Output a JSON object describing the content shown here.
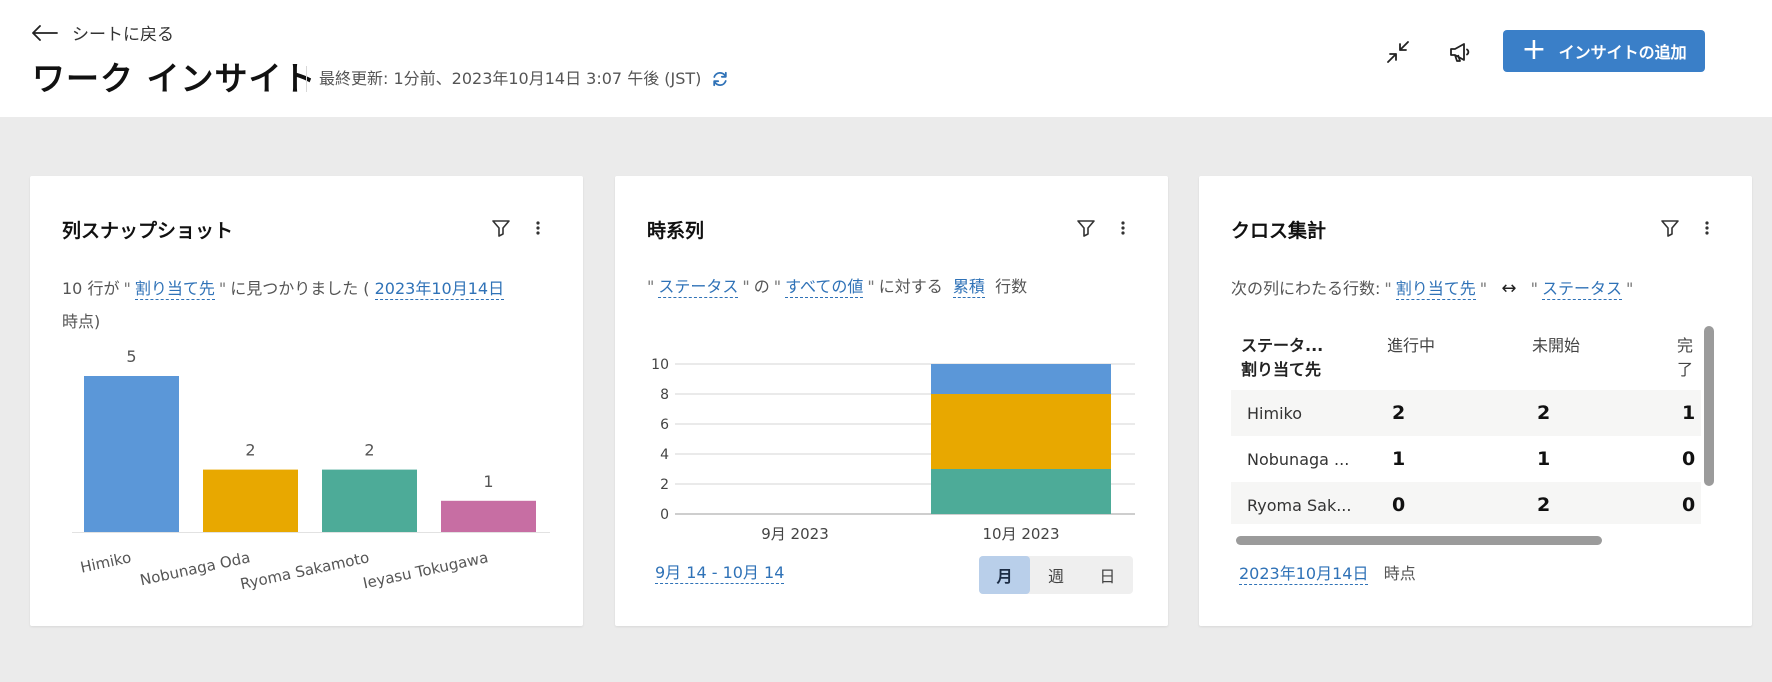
{
  "header": {
    "back_label": "シートに戻る",
    "title": "ワーク インサイト",
    "updated": "最終更新: 1分前、2023年10月14日 3:07 午後 (JST)",
    "add_button_label": "インサイトの追加"
  },
  "colors": {
    "accent": "#3a7fc8",
    "link": "#2f72b7",
    "blue": "#5b97d8",
    "orange": "#e8a800",
    "teal": "#4dab98",
    "pink": "#c76ea3"
  },
  "card1": {
    "title": "列スナップショット",
    "desc_prefix": "10 行が",
    "desc_link1": "割り当て先",
    "desc_mid": "に見つかりました (",
    "desc_link2": "2023年10月14日",
    "desc_suffix": "時点)",
    "chart_data": {
      "type": "bar",
      "categories": [
        "Himiko",
        "Nobunaga Oda",
        "Ryoma Sakamoto",
        "Ieyasu Tokugawa"
      ],
      "values": [
        5,
        2,
        2,
        1
      ],
      "ylim": [
        0,
        5
      ]
    }
  },
  "card2": {
    "title": "時系列",
    "desc_link1": "ステータス",
    "desc_of": "の",
    "desc_link2": "すべての値",
    "desc_for": "に対する",
    "desc_link3": "累積",
    "desc_suffix": "行数",
    "date_range": "9月 14 - 10月 14",
    "segments": [
      "月",
      "週",
      "日"
    ],
    "active_segment": "月",
    "chart_data": {
      "type": "bar",
      "stacked": true,
      "categories": [
        "9月 2023",
        "10月 2023"
      ],
      "series": [
        {
          "values": [
            0,
            3
          ]
        },
        {
          "values": [
            0,
            5
          ]
        },
        {
          "values": [
            0,
            2
          ]
        }
      ],
      "ylim": [
        0,
        10
      ],
      "yticks": [
        "0",
        "2",
        "4",
        "6",
        "8",
        "10"
      ],
      "grid": true
    }
  },
  "card3": {
    "title": "クロス集計",
    "desc_prefix": "次の列にわたる行数:",
    "desc_link1": "割り当て先",
    "desc_arrow": "↔",
    "desc_link2": "ステータス",
    "corner_top": "ステータ...",
    "corner_bottom": "割り当て先",
    "columns": [
      "進行中",
      "未開始",
      "完了"
    ],
    "rows": [
      {
        "name": "Himiko",
        "values": [
          "2",
          "2",
          "1"
        ]
      },
      {
        "name": "Nobunaga ...",
        "values": [
          "1",
          "1",
          "0"
        ]
      },
      {
        "name": "Ryoma Sak...",
        "values": [
          "0",
          "2",
          "0"
        ]
      }
    ],
    "footer_link": "2023年10月14日",
    "footer_suffix": "時点"
  }
}
